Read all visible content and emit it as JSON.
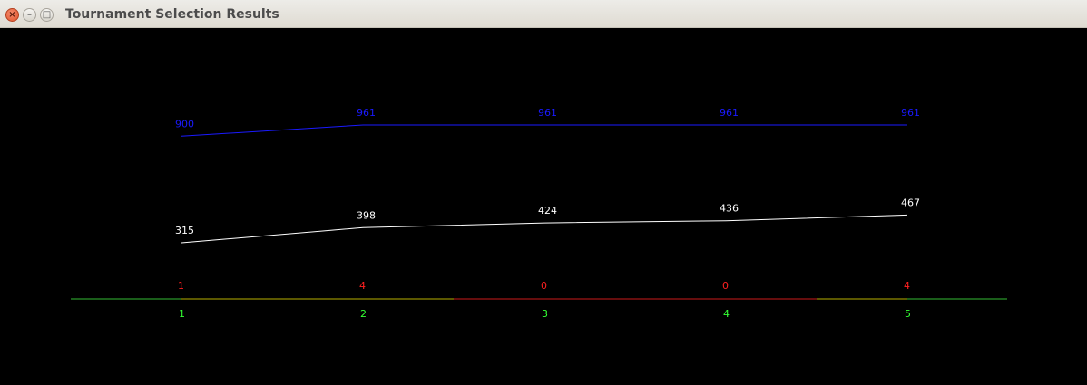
{
  "window": {
    "title": "Tournament Selection Results",
    "close_glyph": "×",
    "minimize_glyph": "–",
    "maximize_glyph": "□"
  },
  "chart_data": {
    "type": "line",
    "x": [
      1,
      2,
      3,
      4,
      5
    ],
    "series": [
      {
        "values": [
          900,
          961,
          961,
          961,
          961
        ],
        "color": "#1a1aff"
      },
      {
        "values": [
          315,
          398,
          424,
          436,
          467
        ],
        "color": "#ffffff"
      }
    ],
    "markers": [
      1,
      4,
      0,
      0,
      4
    ],
    "colors": {
      "best": "#1a1aff",
      "average": "#ffffff",
      "markers": "#ff2020",
      "x_labels": "#33ff33",
      "axis_default": "#33bb33",
      "segment_yellow": "#b8b000",
      "segment_red": "#cc1a1a"
    }
  }
}
